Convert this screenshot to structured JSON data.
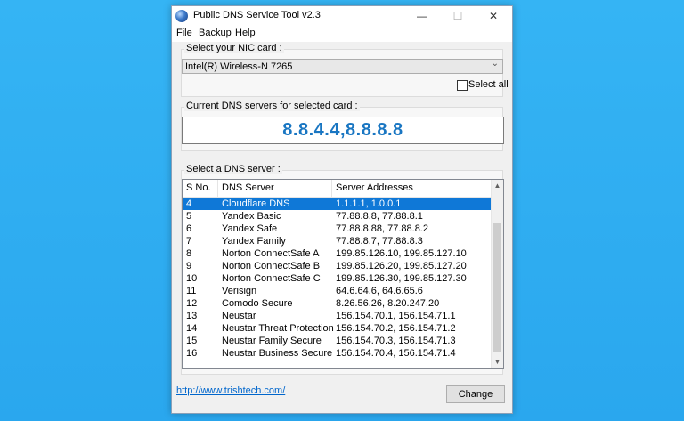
{
  "window": {
    "title": "Public DNS Service Tool v2.3",
    "minimize": "—",
    "maximize": "☐",
    "close": "✕"
  },
  "menu": {
    "items": [
      "File",
      "Backup",
      "Help"
    ]
  },
  "nic": {
    "group_label": "Select your NIC card :",
    "selected": "Intel(R) Wireless-N 7265",
    "dropdown_arrow": "⌄",
    "select_all_label": "Select all",
    "select_all_checked": false
  },
  "current": {
    "group_label": "Current DNS servers for selected card :",
    "value": "8.8.4.4,8.8.8.8"
  },
  "dns_list": {
    "group_label": "Select a DNS server :",
    "columns": [
      "S No.",
      "DNS Server",
      "Server Addresses"
    ],
    "selected_index": 0,
    "rows": [
      {
        "sno": "4",
        "name": "Cloudflare DNS",
        "addr": "1.1.1.1, 1.0.0.1"
      },
      {
        "sno": "5",
        "name": "Yandex Basic",
        "addr": "77.88.8.8, 77.88.8.1"
      },
      {
        "sno": "6",
        "name": "Yandex Safe",
        "addr": "77.88.8.88, 77.88.8.2"
      },
      {
        "sno": "7",
        "name": "Yandex Family",
        "addr": "77.88.8.7, 77.88.8.3"
      },
      {
        "sno": "8",
        "name": "Norton ConnectSafe A",
        "addr": "199.85.126.10, 199.85.127.10"
      },
      {
        "sno": "9",
        "name": "Norton ConnectSafe B",
        "addr": "199.85.126.20, 199.85.127.20"
      },
      {
        "sno": "10",
        "name": "Norton ConnectSafe C",
        "addr": "199.85.126.30, 199.85.127.30"
      },
      {
        "sno": "11",
        "name": "Verisign",
        "addr": "64.6.64.6, 64.6.65.6"
      },
      {
        "sno": "12",
        "name": "Comodo Secure",
        "addr": "8.26.56.26, 8.20.247.20"
      },
      {
        "sno": "13",
        "name": "Neustar",
        "addr": "156.154.70.1, 156.154.71.1"
      },
      {
        "sno": "14",
        "name": "Neustar Threat Protection",
        "addr": "156.154.70.2, 156.154.71.2"
      },
      {
        "sno": "15",
        "name": "Neustar Family Secure",
        "addr": "156.154.70.3, 156.154.71.3"
      },
      {
        "sno": "16",
        "name": "Neustar Business Secure",
        "addr": "156.154.70.4, 156.154.71.4"
      }
    ],
    "scroll_up": "▲",
    "scroll_down": "▼"
  },
  "footer": {
    "link": "http://www.trishtech.com/",
    "change_label": "Change"
  },
  "colors": {
    "background": "#2aa7ee",
    "selection": "#0f78d7",
    "dns_value": "#1976c2",
    "link": "#0066cc"
  }
}
